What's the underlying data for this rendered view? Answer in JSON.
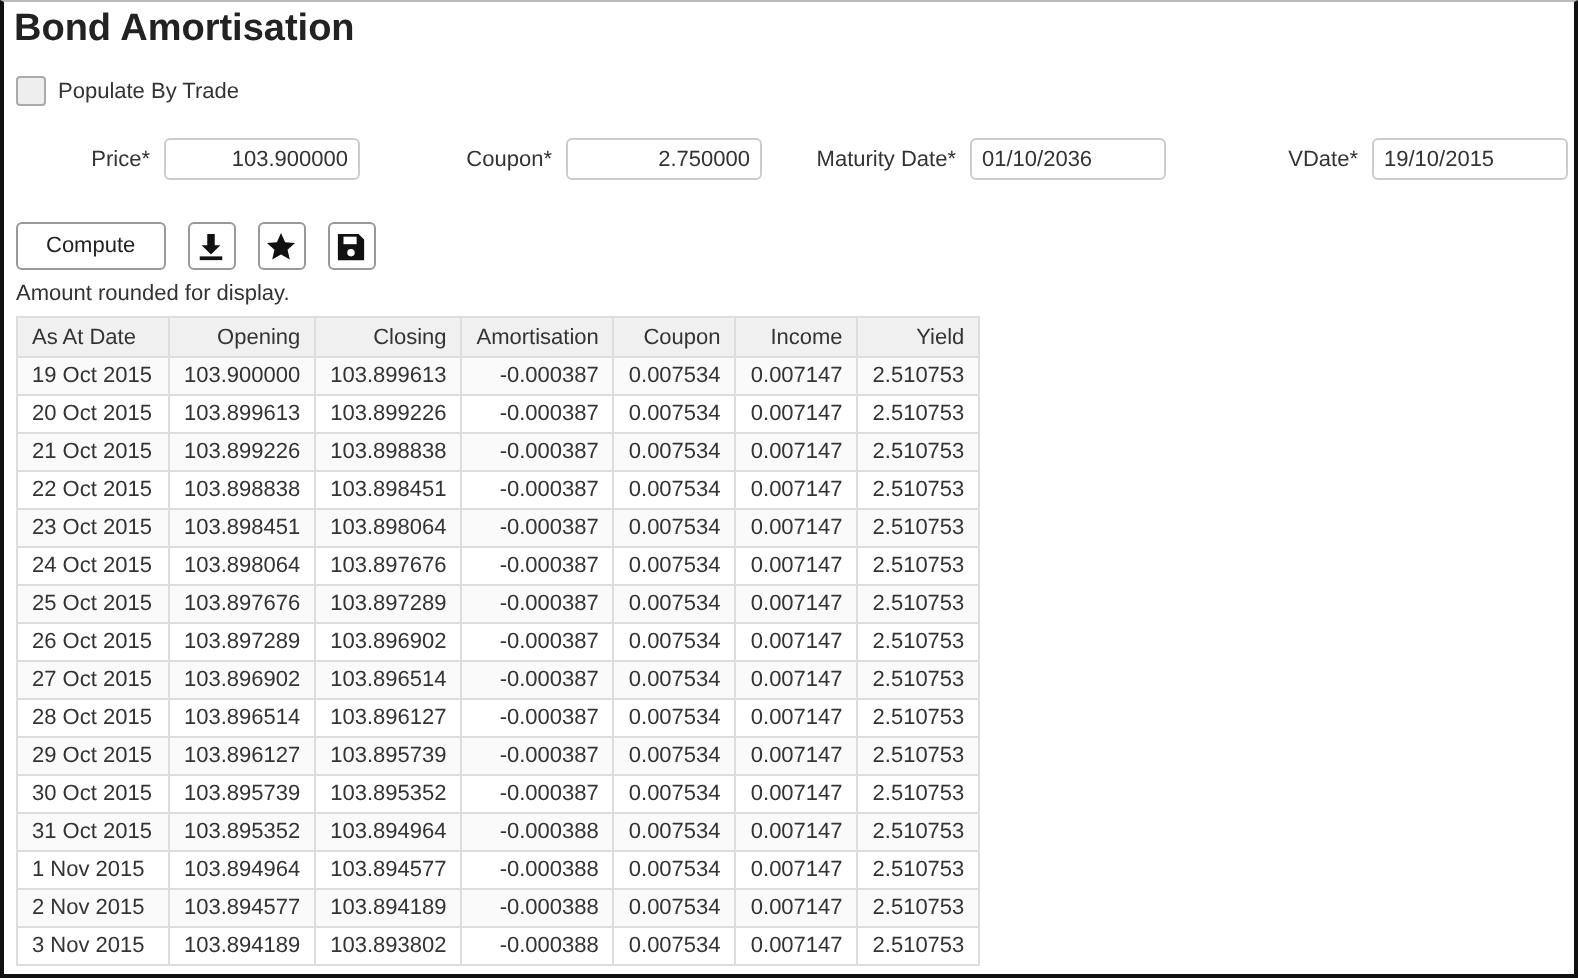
{
  "title": "Bond Amortisation",
  "populate_by_trade": {
    "label": "Populate By Trade",
    "checked": false
  },
  "fields": [
    {
      "label": "Price*",
      "value": "103.900000",
      "kind": "number"
    },
    {
      "label": "Coupon*",
      "value": "2.750000",
      "kind": "number"
    },
    {
      "label": "Maturity Date*",
      "value": "01/10/2036",
      "kind": "date"
    },
    {
      "label": "VDate*",
      "value": "19/10/2015",
      "kind": "date"
    }
  ],
  "toolbar": {
    "compute": "Compute",
    "icons": [
      {
        "kind": "download"
      },
      {
        "kind": "star"
      },
      {
        "kind": "save"
      }
    ]
  },
  "note": "Amount rounded for display.",
  "table": {
    "columns": [
      "As At Date",
      "Opening",
      "Closing",
      "Amortisation",
      "Coupon",
      "Income",
      "Yield"
    ],
    "rows": [
      [
        "19 Oct 2015",
        "103.900000",
        "103.899613",
        "-0.000387",
        "0.007534",
        "0.007147",
        "2.510753"
      ],
      [
        "20 Oct 2015",
        "103.899613",
        "103.899226",
        "-0.000387",
        "0.007534",
        "0.007147",
        "2.510753"
      ],
      [
        "21 Oct 2015",
        "103.899226",
        "103.898838",
        "-0.000387",
        "0.007534",
        "0.007147",
        "2.510753"
      ],
      [
        "22 Oct 2015",
        "103.898838",
        "103.898451",
        "-0.000387",
        "0.007534",
        "0.007147",
        "2.510753"
      ],
      [
        "23 Oct 2015",
        "103.898451",
        "103.898064",
        "-0.000387",
        "0.007534",
        "0.007147",
        "2.510753"
      ],
      [
        "24 Oct 2015",
        "103.898064",
        "103.897676",
        "-0.000387",
        "0.007534",
        "0.007147",
        "2.510753"
      ],
      [
        "25 Oct 2015",
        "103.897676",
        "103.897289",
        "-0.000387",
        "0.007534",
        "0.007147",
        "2.510753"
      ],
      [
        "26 Oct 2015",
        "103.897289",
        "103.896902",
        "-0.000387",
        "0.007534",
        "0.007147",
        "2.510753"
      ],
      [
        "27 Oct 2015",
        "103.896902",
        "103.896514",
        "-0.000387",
        "0.007534",
        "0.007147",
        "2.510753"
      ],
      [
        "28 Oct 2015",
        "103.896514",
        "103.896127",
        "-0.000387",
        "0.007534",
        "0.007147",
        "2.510753"
      ],
      [
        "29 Oct 2015",
        "103.896127",
        "103.895739",
        "-0.000387",
        "0.007534",
        "0.007147",
        "2.510753"
      ],
      [
        "30 Oct 2015",
        "103.895739",
        "103.895352",
        "-0.000387",
        "0.007534",
        "0.007147",
        "2.510753"
      ],
      [
        "31 Oct 2015",
        "103.895352",
        "103.894964",
        "-0.000388",
        "0.007534",
        "0.007147",
        "2.510753"
      ],
      [
        "1 Nov 2015",
        "103.894964",
        "103.894577",
        "-0.000388",
        "0.007534",
        "0.007147",
        "2.510753"
      ],
      [
        "2 Nov 2015",
        "103.894577",
        "103.894189",
        "-0.000388",
        "0.007534",
        "0.007147",
        "2.510753"
      ],
      [
        "3 Nov 2015",
        "103.894189",
        "103.893802",
        "-0.000388",
        "0.007534",
        "0.007147",
        "2.510753"
      ]
    ]
  }
}
